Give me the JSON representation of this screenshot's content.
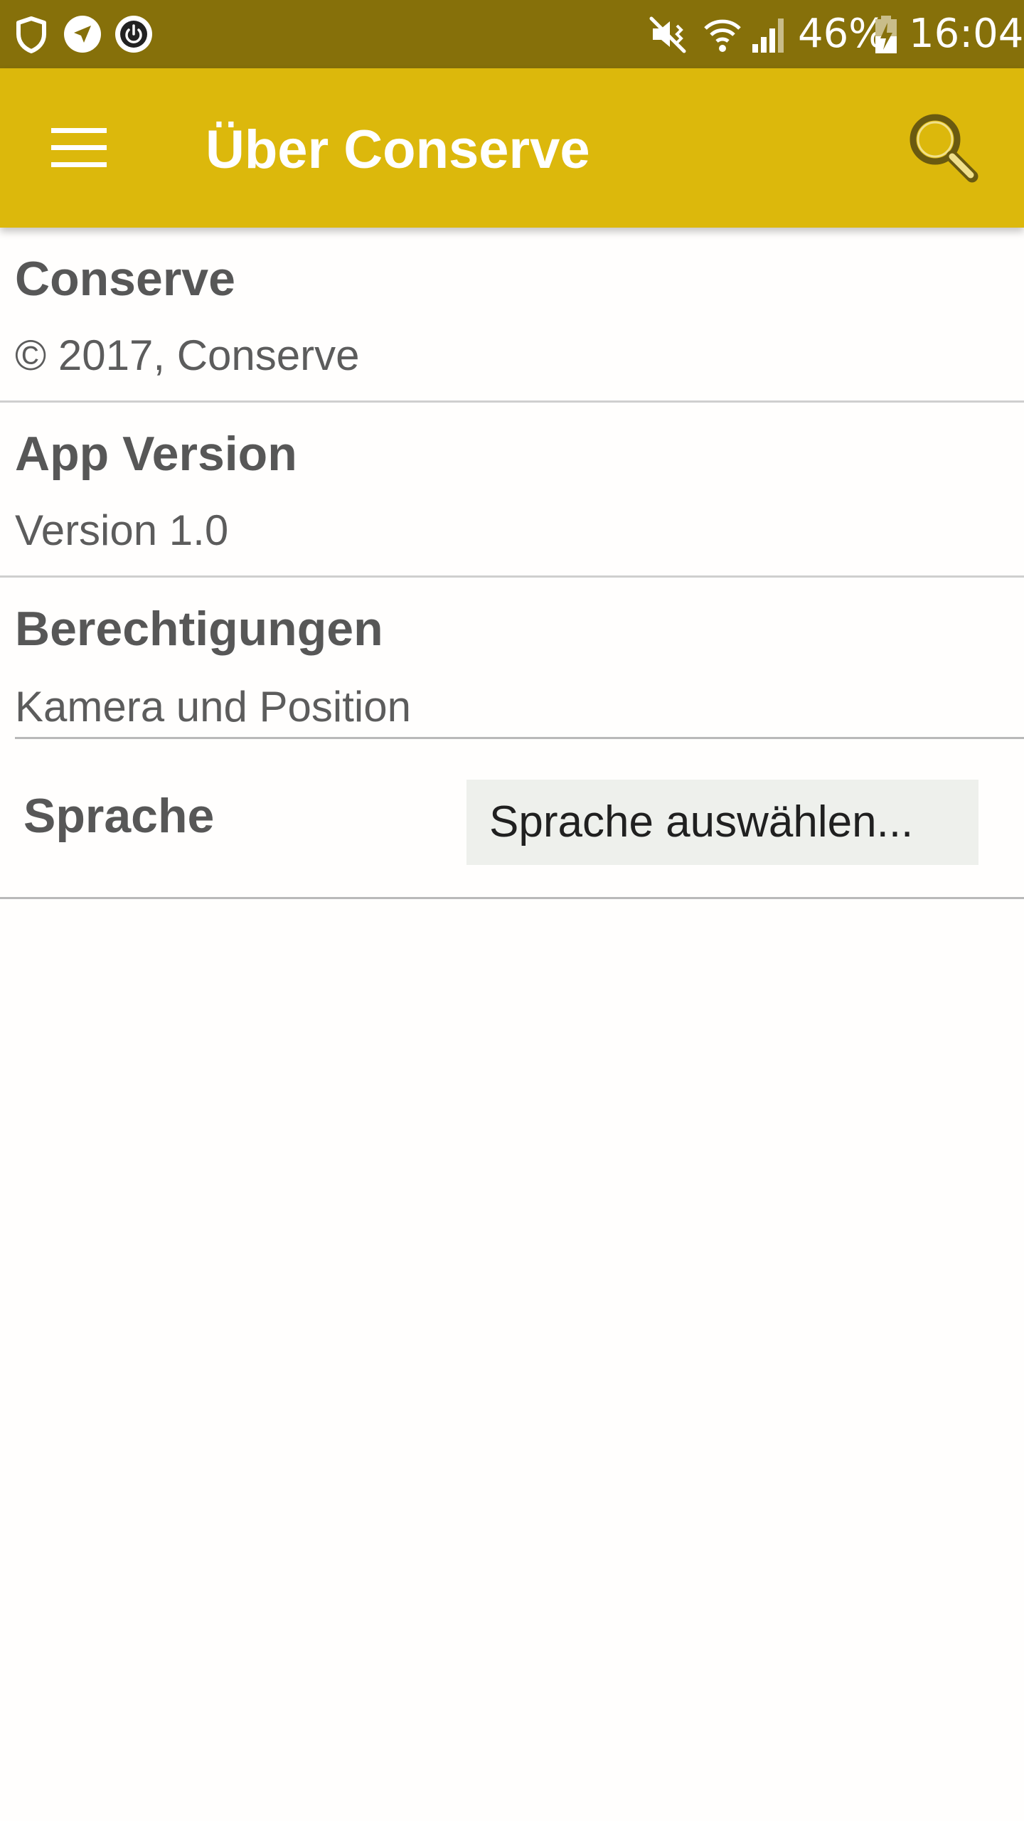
{
  "status_bar": {
    "left_icons": [
      "shield-icon",
      "navigation-icon",
      "power-icon"
    ],
    "right_icons": [
      "vibrate-mute-icon",
      "wifi-icon",
      "signal-icon",
      "battery-charging-icon"
    ],
    "battery_percent": "46%",
    "clock": "16:04",
    "background_color": "#86700a"
  },
  "app_bar": {
    "title": "Über Conserve",
    "menu_icon": "hamburger-menu-icon",
    "search_icon": "search-icon",
    "background_color": "#dcb80c"
  },
  "about": {
    "app": {
      "title": "Conserve",
      "subtitle": "© 2017, Conserve"
    },
    "version": {
      "title": "App Version",
      "subtitle": "Version 1.0"
    },
    "permissions": {
      "title": "Berechtigungen",
      "subtitle": "Kamera und Position"
    },
    "language": {
      "label": "Sprache",
      "select_value": "Sprache auswählen..."
    }
  }
}
